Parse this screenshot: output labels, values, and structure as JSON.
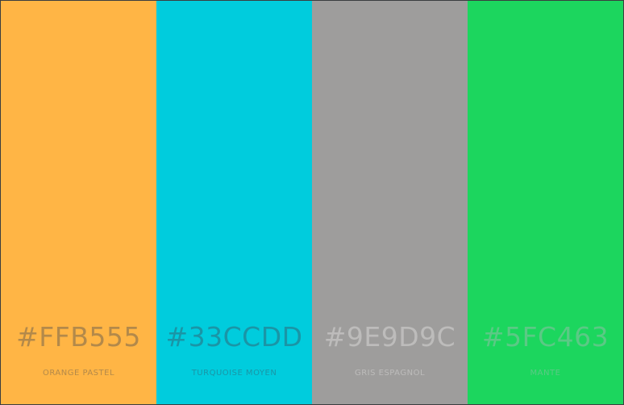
{
  "swatches": [
    {
      "hex": "#FFB555",
      "name": "ORANGE PASTEL",
      "color": "#FFB545",
      "text_color": "#B3894A"
    },
    {
      "hex": "#33CCDD",
      "name": "TURQUOISE MOYEN",
      "color": "#00CCDD",
      "text_color": "#1A95A6"
    },
    {
      "hex": "#9E9D9C",
      "name": "GRIS ESPAGNOL",
      "color": "#9E9D9C",
      "text_color": "#BDBCBB"
    },
    {
      "hex": "#5FC463",
      "name": "MANTE",
      "color": "#1CD65E",
      "text_color": "#5BC985"
    }
  ]
}
